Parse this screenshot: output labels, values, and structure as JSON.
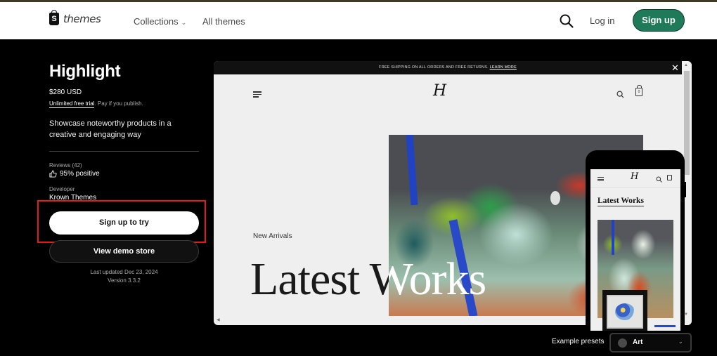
{
  "header": {
    "logo_text": "themes",
    "logo_letter": "S",
    "nav": {
      "collections": "Collections",
      "collections_chevron": "⌄",
      "all_themes": "All themes"
    },
    "login": "Log in",
    "signup": "Sign up",
    "signup_color": "#1f7a5a"
  },
  "theme": {
    "name": "Highlight",
    "price": "$280 USD",
    "trial_link": "Unlimited free trial",
    "trial_rest": ". Pay if you publish.",
    "description": "Showcase noteworthy products in a creative and engaging way",
    "reviews_label": "Reviews (42)",
    "reviews_value": "95% positive",
    "developer_label": "Developer",
    "developer_value": "Krown Themes",
    "try_button": "Sign up to try",
    "demo_button": "View demo store",
    "last_updated": "Last updated Dec 23, 2024",
    "version": "Version 3.3.2",
    "highlight_color": "#e41b17"
  },
  "preview": {
    "announcement": "FREE SHIPPING ON ALL ORDERS AND FREE RETURNS.",
    "announcement_link": "LEARN MORE",
    "close": "✕",
    "store_logo": "H",
    "cart_count": "0",
    "eyebrow": "New Arrivals",
    "hero_title": "Latest Works",
    "hero_title_white": "Works"
  },
  "mobile_preview": {
    "store_logo": "H",
    "title": "Latest Works"
  },
  "presets": {
    "label": "Example presets",
    "selected": "Art",
    "chevron": "⌄"
  }
}
